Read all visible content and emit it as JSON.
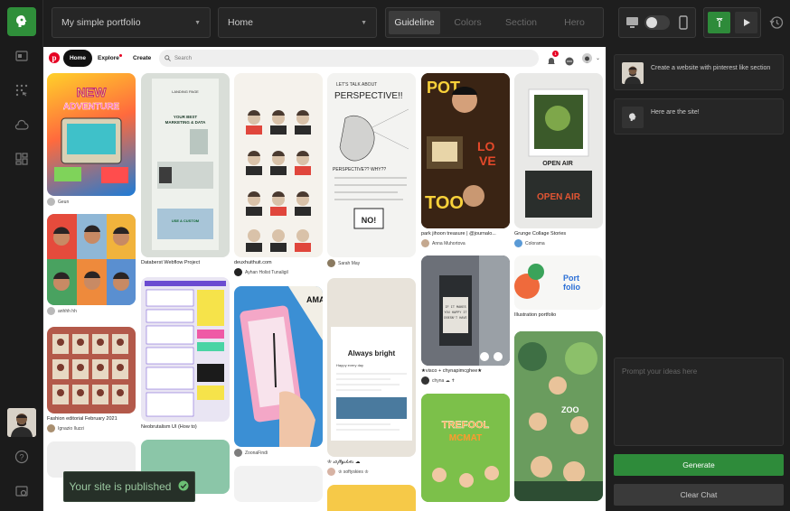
{
  "topbar": {
    "project_select": "My simple portfolio",
    "page_select": "Home",
    "tabs": [
      "Guideline",
      "Colors",
      "Section",
      "Hero"
    ],
    "active_tab": "Guideline"
  },
  "pinterest": {
    "nav_home": "Home",
    "nav_explore": "Explore",
    "nav_create": "Create",
    "search_placeholder": "Search",
    "notif_count": "1"
  },
  "pins": {
    "c1": [
      {
        "author": "Geun"
      },
      {
        "author": "anhhh hh"
      },
      {
        "title": "Fashion editorial February 2021",
        "author": "Ignazio Iluzzi"
      }
    ],
    "c2": [
      {
        "title": "Databerst Webflow Project"
      },
      {
        "title": "Neobrutalism UI (How to)"
      }
    ],
    "c3": [
      {
        "title": "deuxhuithuit.com",
        "author": "Ayhan Holist Tunaligil"
      },
      {
        "author": "ZoonaFindi"
      }
    ],
    "c4": [
      {
        "author": "Sarah May"
      },
      {
        "title": "Always bright",
        "title2": "♔ 𝓈𝑜𝒻𝓉𝓎𝓈𝓀𝒾𝑒𝓈 ☁︎",
        "author": "♔ softyskies ♔"
      }
    ],
    "c5": [
      {
        "title": "park jihoon treasure | @journalo...",
        "author": "Anna Muhortova"
      },
      {
        "title": "★visco + chynapimcghee★",
        "author": "chyna ☁ ✝"
      }
    ],
    "c6": [
      {
        "title": "Grunge Collage Stories",
        "author": "Colorama"
      },
      {
        "title": "Illustration portfolio"
      }
    ]
  },
  "chat": {
    "user_message": "Create a website with pinterest like section",
    "bot_message": "Here are the site!",
    "prompt_placeholder": "Prompt your ideas here",
    "generate_label": "Generate",
    "clear_label": "Clear Chat"
  },
  "toast": {
    "text": "Your site is published"
  }
}
